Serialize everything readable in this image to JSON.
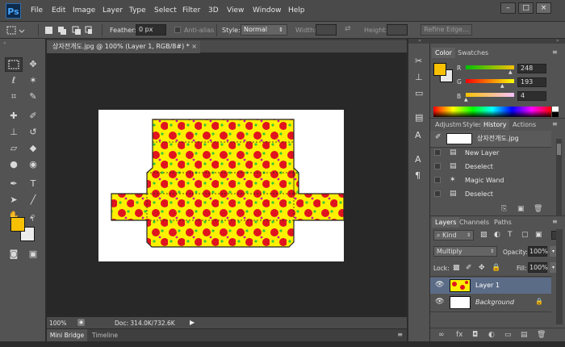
{
  "app": {
    "logo": "Ps"
  },
  "menu": [
    "File",
    "Edit",
    "Image",
    "Layer",
    "Type",
    "Select",
    "Filter",
    "3D",
    "View",
    "Window",
    "Help"
  ],
  "window_controls": {
    "minimize": "–",
    "restore": "□",
    "close": "×"
  },
  "options": {
    "feather_label": "Feather:",
    "feather_value": "0 px",
    "antialias_label": "Anti-alias",
    "style_label": "Style:",
    "style_value": "Normal",
    "width_label": "Width:",
    "height_label": "Height:",
    "refine_label": "Refine Edge..."
  },
  "document": {
    "tab_title": "상자전개도.jpg @ 100% (Layer 1, RGB/8#) *",
    "zoom": "100%",
    "doc_info": "Doc: 314.0K/732.6K"
  },
  "bottom_tabs": [
    "Mini Bridge",
    "Timeline"
  ],
  "color_panel": {
    "tabs": [
      "Color",
      "Swatches"
    ],
    "r_label": "R",
    "g_label": "G",
    "b_label": "B",
    "r": "248",
    "g": "193",
    "b": "4",
    "foreground": "#f8c104"
  },
  "history_panel": {
    "tabs": [
      "Adjustm",
      "Styles",
      "History",
      "Actions"
    ],
    "snapshot": "상자전개도.jpg",
    "items": [
      "New Layer",
      "Deselect",
      "Magic Wand",
      "Deselect"
    ]
  },
  "layers_panel": {
    "tabs": [
      "Layers",
      "Channels",
      "Paths"
    ],
    "kind_label": "Kind",
    "blend_mode": "Multiply",
    "opacity_label": "Opacity:",
    "opacity": "100%",
    "lock_label": "Lock:",
    "fill_label": "Fill:",
    "fill": "100%",
    "layers": [
      {
        "name": "Layer 1",
        "selected": true
      },
      {
        "name": "Background",
        "selected": false
      }
    ]
  },
  "colors": {
    "accent_selected_layer": "#5b6c87",
    "pattern_yellow": "#fff000",
    "pattern_red": "#e0141e",
    "pattern_green": "#35c63a"
  }
}
